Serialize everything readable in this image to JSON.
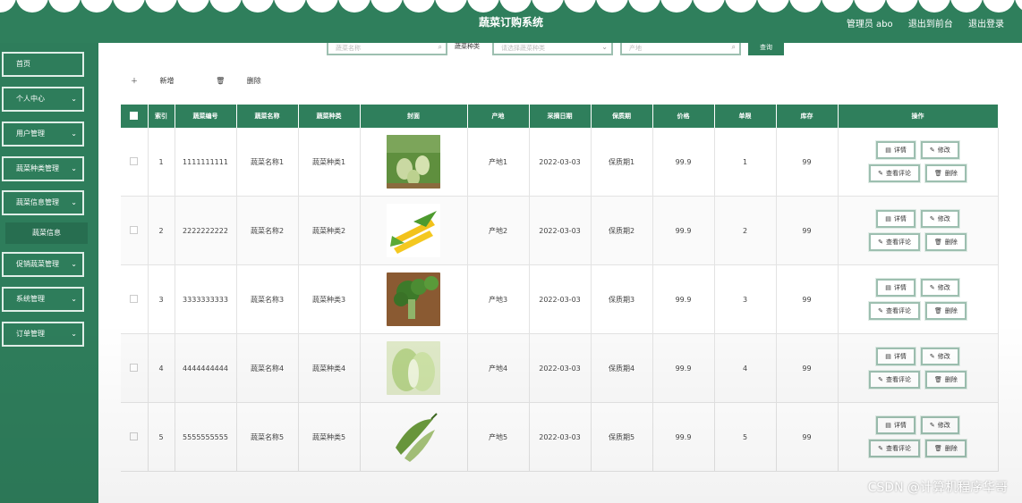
{
  "app": {
    "title": "蔬菜订购系统"
  },
  "header": {
    "user": "管理员 abo",
    "front_label": "退出到前台",
    "logout_label": "退出登录"
  },
  "sidebar": {
    "items": [
      {
        "label": "首页",
        "chevron": false
      },
      {
        "label": "个人中心",
        "chevron": true
      },
      {
        "label": "用户管理",
        "chevron": true
      },
      {
        "label": "蔬菜种类管理",
        "chevron": true
      },
      {
        "label": "蔬菜信息管理",
        "chevron": true
      },
      {
        "label": "促销蔬菜管理",
        "chevron": true
      },
      {
        "label": "系统管理",
        "chevron": true
      },
      {
        "label": "订单管理",
        "chevron": true
      }
    ],
    "sub_item": "蔬菜信息"
  },
  "search": {
    "name_placeholder": "蔬菜名称",
    "type_label": "蔬菜种类",
    "type_placeholder": "请选择蔬菜种类",
    "origin_placeholder": "产地",
    "query_label": "查询"
  },
  "toolbar": {
    "add_label": "新增",
    "delete_label": "删除"
  },
  "table": {
    "headers": [
      "索引",
      "蔬菜编号",
      "蔬菜名称",
      "蔬菜种类",
      "封面",
      "产地",
      "采摘日期",
      "保质期",
      "价格",
      "单限",
      "库存",
      "操作"
    ],
    "rows": [
      {
        "index": "1",
        "code": "1111111111",
        "name": "蔬菜名称1",
        "type": "蔬菜种类1",
        "origin": "产地1",
        "date": "2022-03-03",
        "shelf": "保质期1",
        "price": "99.9",
        "limit": "1",
        "stock": "99",
        "cover": "gourd"
      },
      {
        "index": "2",
        "code": "2222222222",
        "name": "蔬菜名称2",
        "type": "蔬菜种类2",
        "origin": "产地2",
        "date": "2022-03-03",
        "shelf": "保质期2",
        "price": "99.9",
        "limit": "2",
        "stock": "99",
        "cover": "corn"
      },
      {
        "index": "3",
        "code": "3333333333",
        "name": "蔬菜名称3",
        "type": "蔬菜种类3",
        "origin": "产地3",
        "date": "2022-03-03",
        "shelf": "保质期3",
        "price": "99.9",
        "limit": "3",
        "stock": "99",
        "cover": "broccoli"
      },
      {
        "index": "4",
        "code": "4444444444",
        "name": "蔬菜名称4",
        "type": "蔬菜种类4",
        "origin": "产地4",
        "date": "2022-03-03",
        "shelf": "保质期4",
        "price": "99.9",
        "limit": "4",
        "stock": "99",
        "cover": "cabbage"
      },
      {
        "index": "5",
        "code": "5555555555",
        "name": "蔬菜名称5",
        "type": "蔬菜种类5",
        "origin": "产地5",
        "date": "2022-03-03",
        "shelf": "保质期5",
        "price": "99.9",
        "limit": "5",
        "stock": "99",
        "cover": "bittergourd"
      }
    ],
    "ops": {
      "detail": "详情",
      "edit": "修改",
      "review": "查看评论",
      "delete": "删除"
    }
  },
  "watermark": "CSDN @计算机程序华哥",
  "colors": {
    "primary": "#2f7f5c",
    "border": "#9dbfb0"
  }
}
